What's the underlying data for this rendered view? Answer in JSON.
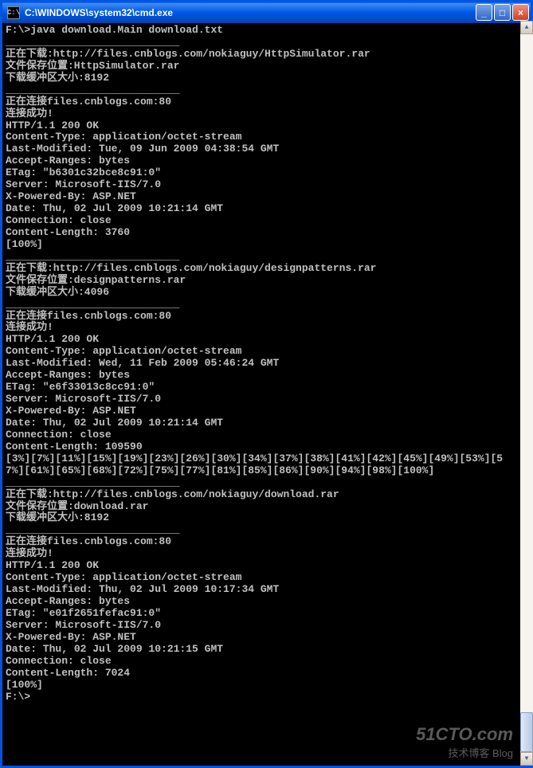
{
  "window": {
    "icon_text": "C:\\",
    "title": "C:\\WINDOWS\\system32\\cmd.exe",
    "minimize": "_",
    "maximize": "□",
    "close": "×"
  },
  "scrollbar": {
    "up": "▲",
    "down": "▼"
  },
  "watermark": {
    "logo": "51CTO.com",
    "sub": "技术博客    Blog"
  },
  "console": {
    "sep": "____________________________",
    "prompt1": "F:\\>java download.Main download.txt",
    "prompt2": "F:\\>",
    "blank": "",
    "d1": {
      "line1": "正在下载:http://files.cnblogs.com/nokiaguy/HttpSimulator.rar",
      "line2": "文件保存位置:HttpSimulator.rar",
      "line3": "下载缓冲区大小:8192",
      "conn": "正在连接files.cnblogs.com:80",
      "connok": "连接成功!",
      "h1": "HTTP/1.1 200 OK",
      "h2": "Content-Type: application/octet-stream",
      "h3": "Last-Modified: Tue, 09 Jun 2009 04:38:54 GMT",
      "h4": "Accept-Ranges: bytes",
      "h5": "ETag: \"b6301c32bce8c91:0\"",
      "h6": "Server: Microsoft-IIS/7.0",
      "h7": "X-Powered-By: ASP.NET",
      "h8": "Date: Thu, 02 Jul 2009 10:21:14 GMT",
      "h9": "Connection: close",
      "h10": "Content-Length: 3760",
      "prog": "[100%]"
    },
    "d2": {
      "line1": "正在下载:http://files.cnblogs.com/nokiaguy/designpatterns.rar",
      "line2": "文件保存位置:designpatterns.rar",
      "line3": "下载缓冲区大小:4096",
      "conn": "正在连接files.cnblogs.com:80",
      "connok": "连接成功!",
      "h1": "HTTP/1.1 200 OK",
      "h2": "Content-Type: application/octet-stream",
      "h3": "Last-Modified: Wed, 11 Feb 2009 05:46:24 GMT",
      "h4": "Accept-Ranges: bytes",
      "h5": "ETag: \"e6f33013c8cc91:0\"",
      "h6": "Server: Microsoft-IIS/7.0",
      "h7": "X-Powered-By: ASP.NET",
      "h8": "Date: Thu, 02 Jul 2009 10:21:14 GMT",
      "h9": "Connection: close",
      "h10": "Content-Length: 109590",
      "prog1": "[3%][7%][11%][15%][19%][23%][26%][30%][34%][37%][38%][41%][42%][45%][49%][53%][5",
      "prog2": "7%][61%][65%][68%][72%][75%][77%][81%][85%][86%][90%][94%][98%][100%]"
    },
    "d3": {
      "line1": "正在下载:http://files.cnblogs.com/nokiaguy/download.rar",
      "line2": "文件保存位置:download.rar",
      "line3": "下载缓冲区大小:8192",
      "conn": "正在连接files.cnblogs.com:80",
      "connok": "连接成功!",
      "h1": "HTTP/1.1 200 OK",
      "h2": "Content-Type: application/octet-stream",
      "h3": "Last-Modified: Thu, 02 Jul 2009 10:17:34 GMT",
      "h4": "Accept-Ranges: bytes",
      "h5": "ETag: \"e01f2651fefac91:0\"",
      "h6": "Server: Microsoft-IIS/7.0",
      "h7": "X-Powered-By: ASP.NET",
      "h8": "Date: Thu, 02 Jul 2009 10:21:15 GMT",
      "h9": "Connection: close",
      "h10": "Content-Length: 7024",
      "prog": "[100%]"
    }
  }
}
